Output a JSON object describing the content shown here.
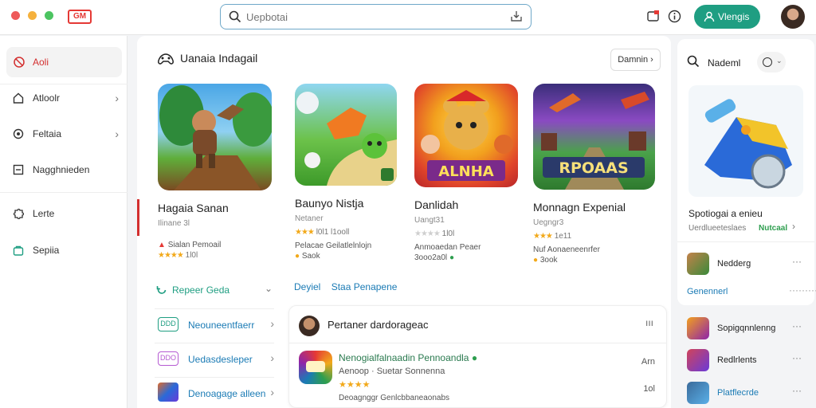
{
  "topbar": {
    "logo_text": "GM",
    "search_placeholder": "Uepbotai",
    "signin_label": "Vlengis"
  },
  "sidebar": {
    "items": [
      {
        "label": "Aoli",
        "icon": "gamepad-icon",
        "active": true
      },
      {
        "label": "Atloolr",
        "icon": "home-icon",
        "chevron": "›"
      },
      {
        "label": "Feltaia",
        "icon": "target-icon",
        "chevron": "›"
      },
      {
        "label": "Nagghnieden",
        "icon": "grid-icon"
      },
      {
        "label": "Lerte",
        "icon": "puzzle-icon"
      },
      {
        "label": "Sepiia",
        "icon": "bag-icon"
      }
    ]
  },
  "main": {
    "section_title": "Uanaia Indagail",
    "details_button": "Damnin ›",
    "games": [
      {
        "name": "Hagaia Sanan",
        "sub": "Ilinane 3l",
        "meta_icon": "▲",
        "meta": "Sialan Pemoail",
        "rating_stars": "★★★★",
        "rating_text": "1l0l"
      },
      {
        "name": "Baunyo Nistja",
        "sub": "Netaner",
        "rating_stars": "★★★",
        "rating_text": "l0l1 l1ooll",
        "meta": "Pelacae Geilatlelnlojn",
        "extra_icon": "●",
        "extra": "Saok"
      },
      {
        "name": "Danlidah",
        "sub": "Uangt31",
        "rating_stars": "★★★★",
        "rating_text": "1l0l",
        "meta": "Anmoaedan Peaer",
        "extra_icon": "●",
        "extra": "3ooo2a0l"
      },
      {
        "name": "Monnagn Expenial",
        "sub": "Uegngr3",
        "rating_stars": "★★★",
        "rating_text": "1e11",
        "meta": "Nuf Aonaeneenrfer",
        "extra_icon": "●",
        "extra": "3ook"
      }
    ],
    "art_titles": [
      "ALNHA",
      "RPOAAS"
    ],
    "feature_link": "Repeer Geda",
    "tabs": [
      "Deyiel",
      "Staa Penapene"
    ],
    "categories": [
      {
        "badge": "DDD",
        "label": "Neouneentfaerr",
        "color": "#1f9e82"
      },
      {
        "badge": "DDO",
        "label": "Uedasdesleper",
        "color": "#b55ad2"
      },
      {
        "badge": "",
        "label": "Denoagage alleen",
        "color": "#1b7bb5"
      }
    ],
    "panel": {
      "title": "Pertaner dardorageac",
      "more": "ııı",
      "game_name": "Nenogialfalnaadin Pennoandla",
      "game_sub": "Aenoop · Suetar Sonnenna",
      "game_stars": "★★★★",
      "game_footer": "Deoagnggr Genlcbbaneaonabs",
      "right_top": "Arn",
      "right_bottom": "1ol"
    }
  },
  "right": {
    "title": "Nademl",
    "game_title": "Spotiogai a enieu",
    "game_sub": "Uerdlueeteslaes",
    "game_link": "Nutcaal",
    "items": [
      {
        "label": "Nedderg",
        "more": "···",
        "thumb": "#c4824a"
      },
      {
        "label": "Sopigqnnlenng",
        "more": "···",
        "thumb": "#8e24aa"
      },
      {
        "label": "Redlrlents",
        "more": "···",
        "thumb": "#d1445a"
      },
      {
        "label": "Platflecrde",
        "more": "···",
        "thumb": "#3a6a9a"
      }
    ],
    "link": "Genennerl",
    "link_more": "·········"
  },
  "colors": {
    "accent": "#1f9e82",
    "brand_red": "#d32f2f",
    "link_blue": "#1b7bb5",
    "star": "#f2a91a"
  }
}
